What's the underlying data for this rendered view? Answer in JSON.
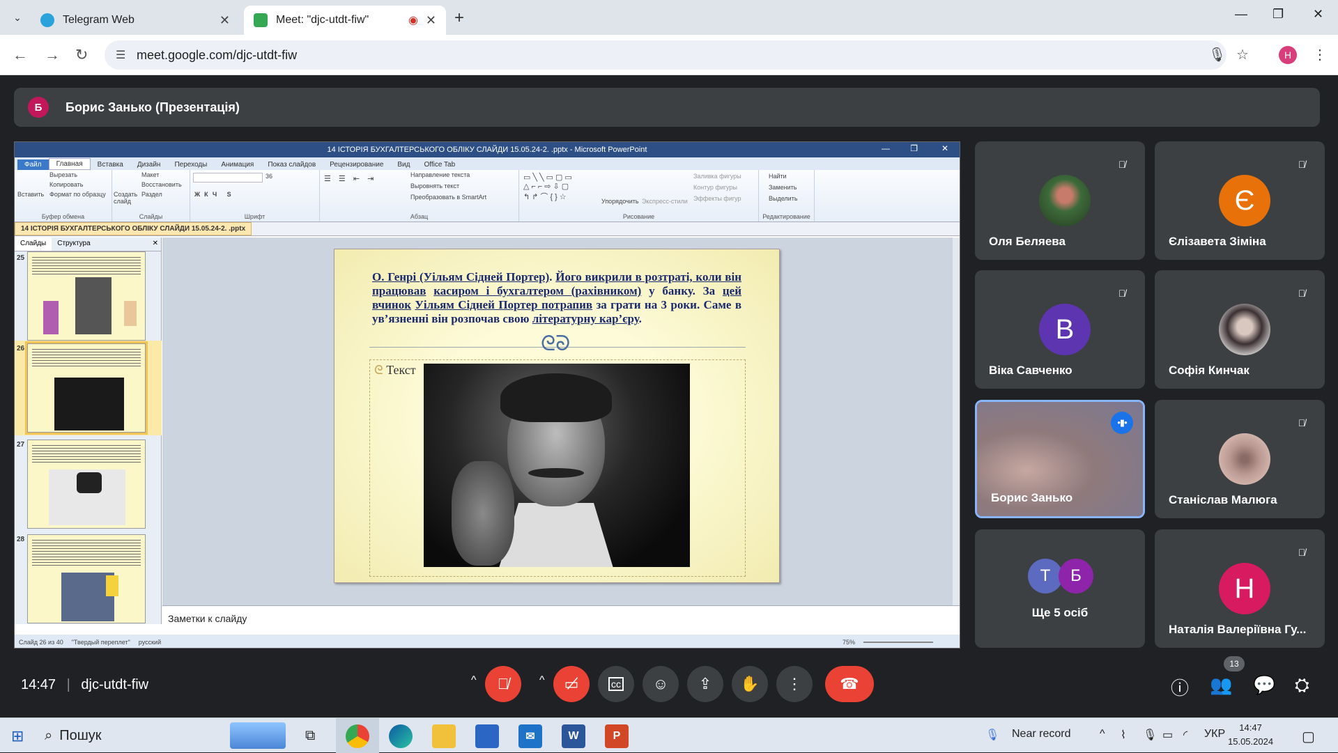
{
  "browser": {
    "tabs": [
      {
        "label": "Telegram Web",
        "favicon_color": "#2aa3dd"
      },
      {
        "label": "Meet: \"djc-utdt-fiw\"",
        "favicon_color": "#34a853"
      }
    ],
    "url": "meet.google.com/djc-utdt-fiw",
    "profile_initial": "H"
  },
  "meet": {
    "presenter_initial": "Б",
    "presenter_title": "Борис Занько (Презентація)",
    "meeting_time": "14:47",
    "meeting_code": "djc-utdt-fiw",
    "participant_count": "13",
    "participants": [
      {
        "name": "Оля Беляева",
        "muted": true
      },
      {
        "name": "Єлізавета Зіміна",
        "initial": "Є",
        "color": "#e8710a",
        "muted": true
      },
      {
        "name": "Віка Савченко",
        "initial": "В",
        "color": "#5e35b1",
        "muted": true
      },
      {
        "name": "Софія Кинчак",
        "muted": true
      },
      {
        "name": "Борис Занько",
        "speaking": true
      },
      {
        "name": "Станіслав Малюга",
        "muted": true
      },
      {
        "name": "Ще 5 осіб",
        "initials": [
          "Т",
          "Б"
        ]
      },
      {
        "name": "Наталія Валеріївна Гу...",
        "initial": "Н",
        "color": "#d81b60",
        "muted": true
      }
    ]
  },
  "powerpoint": {
    "window_title": "14 ІСТОРІЯ БУХГАЛТЕРСЬКОГО ОБЛІКУ СЛАЙДИ 15.05.24-2. .pptx - Microsoft PowerPoint",
    "ribbon_tabs": [
      "Файл",
      "Главная",
      "Вставка",
      "Дизайн",
      "Переходы",
      "Анимация",
      "Показ слайдов",
      "Рецензирование",
      "Вид",
      "Office Tab"
    ],
    "ribbon_groups": [
      "Буфер обмена",
      "Слайды",
      "Шрифт",
      "Абзац",
      "Рисование",
      "Редактирование"
    ],
    "clipboard": {
      "paste": "Вставить",
      "cut": "Вырезать",
      "copy": "Копировать",
      "format": "Формат по образцу"
    },
    "slides_group": {
      "create": "Создать слайд",
      "layout": "Макет",
      "reset": "Восстановить",
      "section": "Раздел"
    },
    "font_size": "36",
    "paragraph": {
      "direction": "Направление текста",
      "align": "Выровнять текст",
      "smartart": "Преобразовать в SmartArt"
    },
    "drawing": {
      "arrange": "Упорядочить",
      "styles": "Экспресс-стили",
      "fill": "Заливка фигуры",
      "outline": "Контур фигуры",
      "effects": "Эффекты фигур"
    },
    "editing": {
      "find": "Найти",
      "replace": "Заменить",
      "select": "Выделить"
    },
    "doc_tab": "14 ІСТОРІЯ БУХГАЛТЕРСЬКОГО ОБЛІКУ СЛАЙДИ 15.05.24-2. .pptx",
    "pane_tabs": [
      "Слайды",
      "Структура"
    ],
    "thumb_numbers": [
      "25",
      "26",
      "27",
      "28"
    ],
    "slide_text_parts": {
      "p1": "О. Генрі (Уільям Сідней Портер)",
      "p2": ". ",
      "p3": "Його викрили в розтраті, коли він працював",
      "p4": " ",
      "p5": "касиром і бухгалтером (рахівником)",
      "p6": " у банку. За ",
      "p7": "цей вчинок",
      "p8": "  ",
      "p9": "Уільям Сідней Портер потрапив",
      "p10": " за грати на 3 роки. Саме в ув’язненні він розпочав свою ",
      "p11": "літературну кар’єру",
      "p12": "."
    },
    "ornament": "ᘓᘐ",
    "placeholder_text": "Текст",
    "notes_label": "Заметки к слайду",
    "status": {
      "slide": "Слайд 26 из 40",
      "theme": "\"Твердый переплет\"",
      "lang": "русский",
      "zoom": "75%"
    }
  },
  "taskbar": {
    "search_label": "Пошук",
    "tray_text": "Near record",
    "lang": "УКР",
    "time": "14:47",
    "date": "15.05.2024"
  }
}
